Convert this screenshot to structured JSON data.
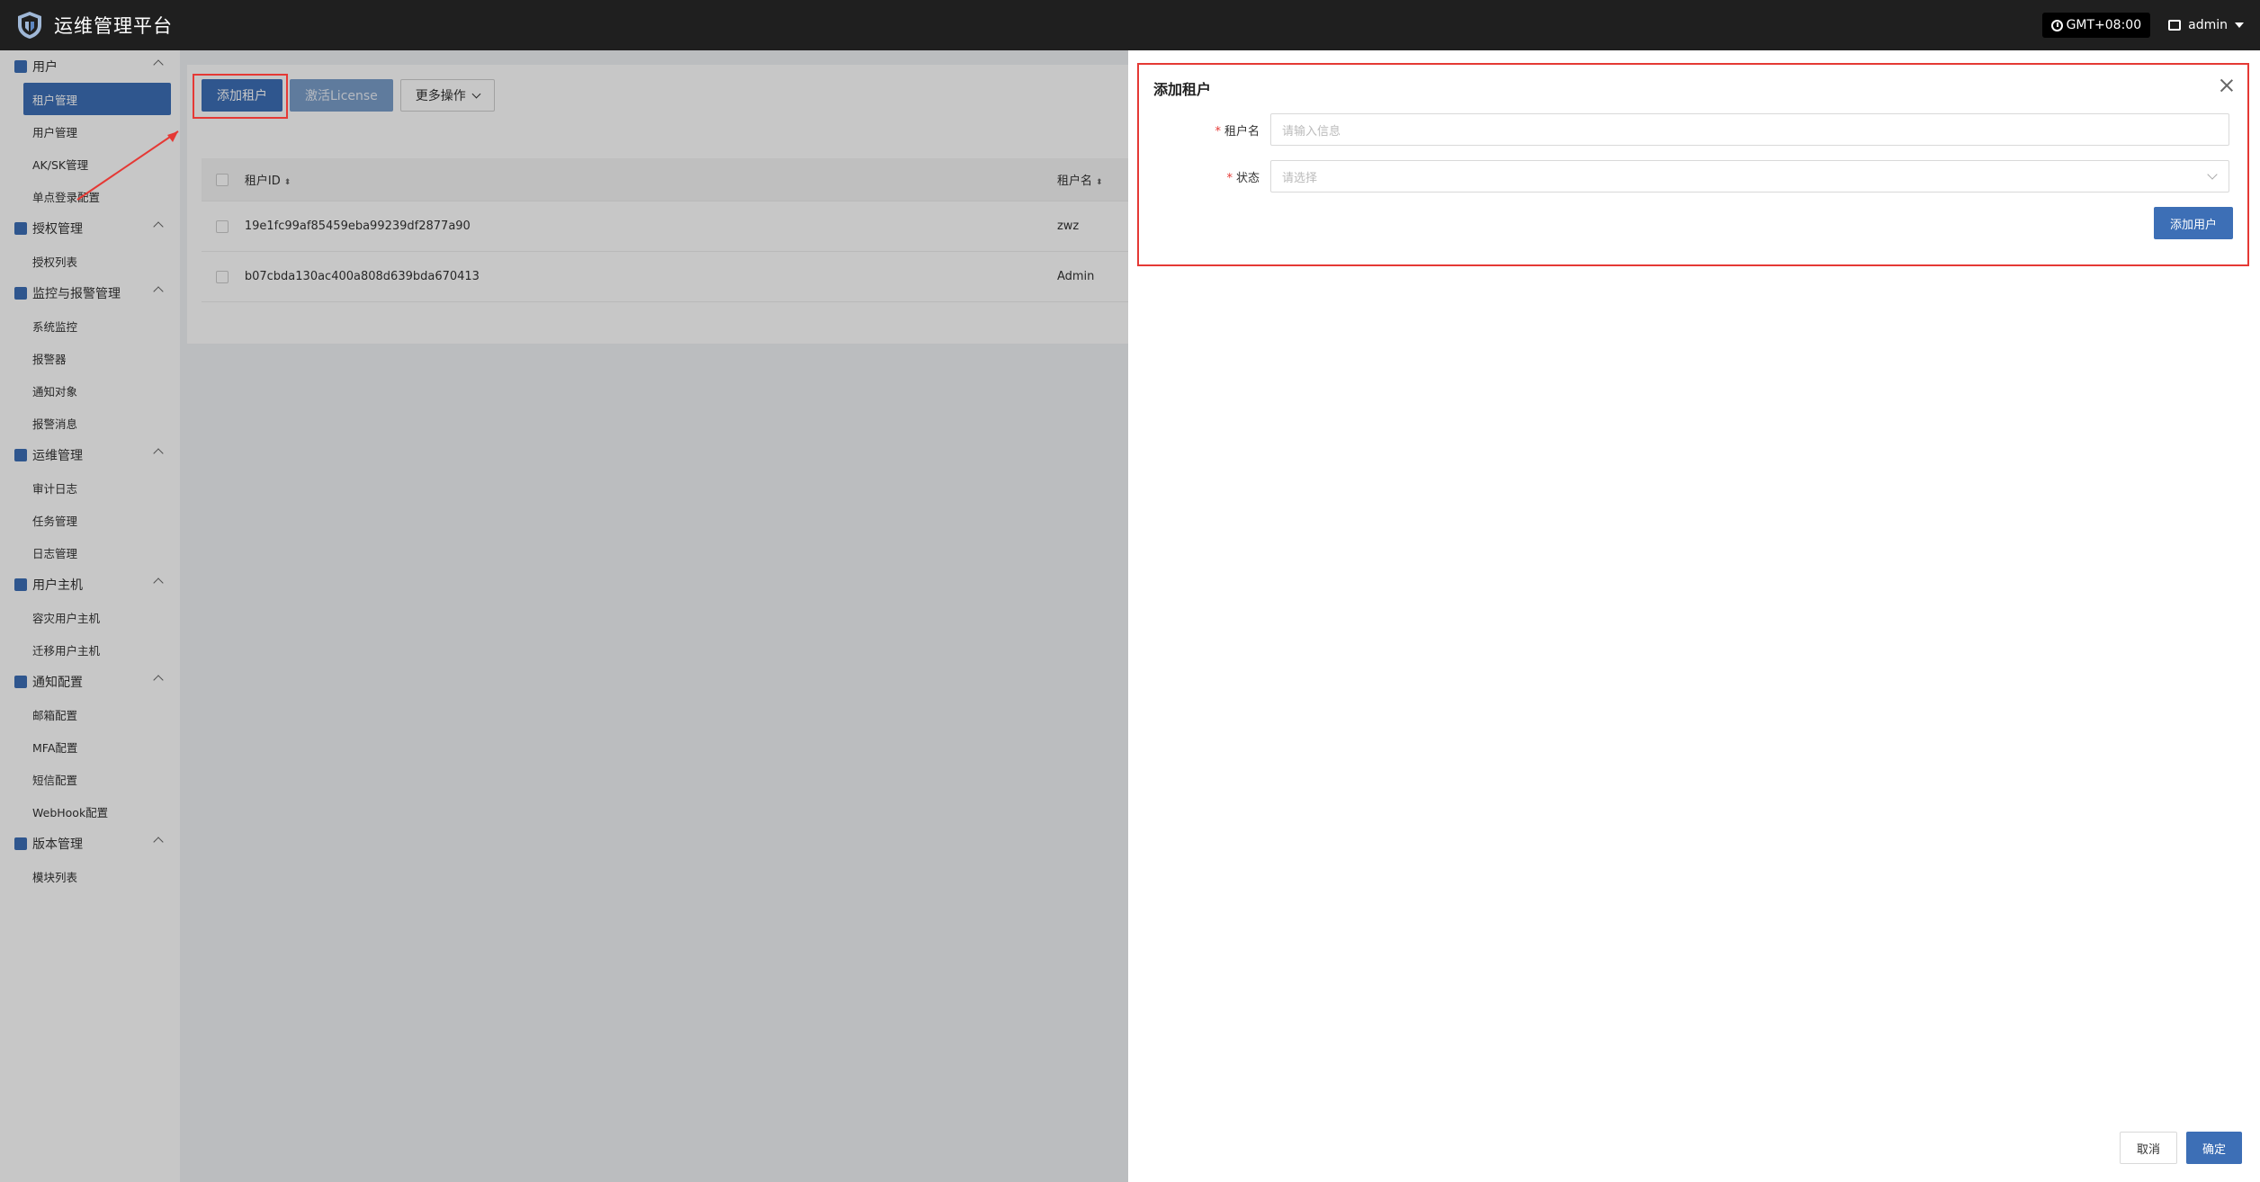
{
  "header": {
    "title": "运维管理平台",
    "timezone": "GMT+08:00",
    "user": "admin"
  },
  "sidebar": {
    "groups": [
      {
        "label": "用户",
        "icon": "user-icon",
        "items": [
          "租户管理",
          "用户管理",
          "AK/SK管理",
          "单点登录配置"
        ]
      },
      {
        "label": "授权管理",
        "icon": "license-icon",
        "items": [
          "授权列表"
        ]
      },
      {
        "label": "监控与报警管理",
        "icon": "alarm-icon",
        "items": [
          "系统监控",
          "报警器",
          "通知对象",
          "报警消息"
        ]
      },
      {
        "label": "运维管理",
        "icon": "tools-icon",
        "items": [
          "审计日志",
          "任务管理",
          "日志管理"
        ]
      },
      {
        "label": "用户主机",
        "icon": "layers-icon",
        "items": [
          "容灾用户主机",
          "迁移用户主机"
        ]
      },
      {
        "label": "通知配置",
        "icon": "gear-icon",
        "items": [
          "邮箱配置",
          "MFA配置",
          "短信配置",
          "WebHook配置"
        ]
      },
      {
        "label": "版本管理",
        "icon": "package-icon",
        "items": [
          "模块列表"
        ]
      }
    ],
    "active_item": "租户管理"
  },
  "toolbar": {
    "add_tenant": "添加租户",
    "activate_license": "激活License",
    "more_actions": "更多操作"
  },
  "table": {
    "columns": [
      "租户ID",
      "租户名"
    ],
    "rows": [
      {
        "id": "19e1fc99af85459eba99239df2877a90",
        "name": "zwz"
      },
      {
        "id": "b07cbda130ac400a808d639bda670413",
        "name": "Admin"
      }
    ]
  },
  "drawer": {
    "title": "添加租户",
    "fields": {
      "tenant_name_label": "租户名",
      "tenant_name_placeholder": "请输入信息",
      "status_label": "状态",
      "status_placeholder": "请选择"
    },
    "add_user": "添加用户",
    "cancel": "取消",
    "confirm": "确定"
  },
  "colors": {
    "primary": "#3d6fb6",
    "highlight": "#e53935",
    "header_bg": "#1f1f1f"
  }
}
